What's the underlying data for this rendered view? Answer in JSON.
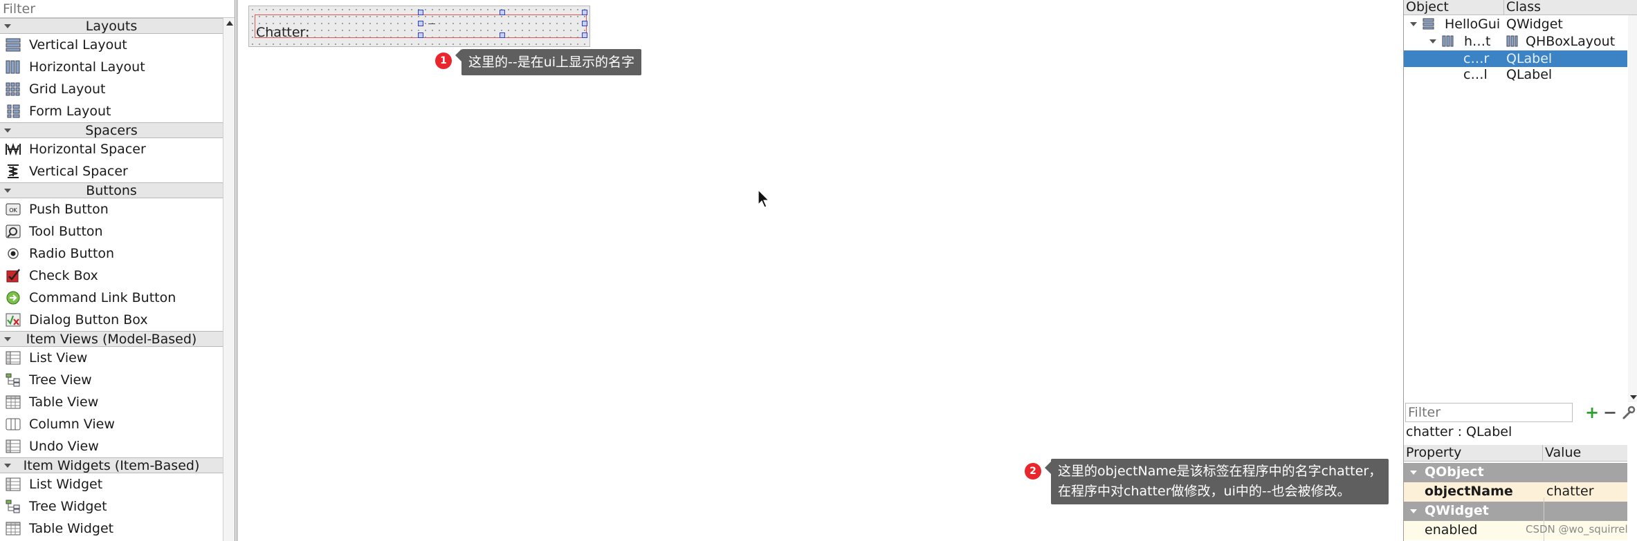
{
  "widget_box": {
    "filter_placeholder": "Filter",
    "categories": [
      {
        "label": "Layouts",
        "items": [
          {
            "label": "Vertical Layout",
            "icon": "vertical-layout-icon"
          },
          {
            "label": "Horizontal Layout",
            "icon": "horizontal-layout-icon"
          },
          {
            "label": "Grid Layout",
            "icon": "grid-layout-icon"
          },
          {
            "label": "Form Layout",
            "icon": "form-layout-icon"
          }
        ]
      },
      {
        "label": "Spacers",
        "items": [
          {
            "label": "Horizontal Spacer",
            "icon": "horizontal-spacer-icon"
          },
          {
            "label": "Vertical Spacer",
            "icon": "vertical-spacer-icon"
          }
        ]
      },
      {
        "label": "Buttons",
        "items": [
          {
            "label": "Push Button",
            "icon": "push-button-icon"
          },
          {
            "label": "Tool Button",
            "icon": "tool-button-icon"
          },
          {
            "label": "Radio Button",
            "icon": "radio-button-icon"
          },
          {
            "label": "Check Box",
            "icon": "check-box-icon"
          },
          {
            "label": "Command Link Button",
            "icon": "command-link-icon"
          },
          {
            "label": "Dialog Button Box",
            "icon": "dialog-button-box-icon"
          }
        ]
      },
      {
        "label": "Item Views (Model-Based)",
        "items": [
          {
            "label": "List View",
            "icon": "list-view-icon"
          },
          {
            "label": "Tree View",
            "icon": "tree-view-icon"
          },
          {
            "label": "Table View",
            "icon": "table-view-icon"
          },
          {
            "label": "Column View",
            "icon": "column-view-icon"
          },
          {
            "label": "Undo View",
            "icon": "undo-view-icon"
          }
        ]
      },
      {
        "label": "Item Widgets (Item-Based)",
        "items": [
          {
            "label": "List Widget",
            "icon": "list-widget-icon"
          },
          {
            "label": "Tree Widget",
            "icon": "tree-widget-icon"
          },
          {
            "label": "Table Widget",
            "icon": "table-widget-icon"
          }
        ]
      }
    ]
  },
  "canvas": {
    "form_label": "Chatter:",
    "selected_text": "--",
    "callout_1": {
      "number": "1",
      "text": "这里的--是在ui上显示的名字"
    },
    "callout_2": {
      "number": "2",
      "line1": "这里的objectName是该标签在程序中的名字chatter，",
      "line2": "在程序中对chatter做修改，ui中的--也会被修改。"
    }
  },
  "object_inspector": {
    "col_object": "Object",
    "col_class": "Class",
    "rows": [
      {
        "object": "HelloGui",
        "class": "QWidget",
        "icon": "widget-icon",
        "selected": false
      },
      {
        "object": "h…t",
        "class": "QHBoxLayout",
        "icon": "hbox-layout-icon",
        "selected": false
      },
      {
        "object": "c…r",
        "class": "QLabel",
        "selected": true
      },
      {
        "object": "c…l",
        "class": "QLabel",
        "selected": false
      }
    ]
  },
  "property_editor": {
    "filter_placeholder": "Filter",
    "title": "chatter : QLabel",
    "col_property": "Property",
    "col_value": "Value",
    "group_qobject": "QObject",
    "object_name_prop": "objectName",
    "object_name_value": "chatter",
    "group_qwidget": "QWidget",
    "enabled_prop": "enabled"
  },
  "watermark": "CSDN @wo_squirrel",
  "colors": {
    "selection": "#3b83c4",
    "badge": "#e8262c",
    "callout": "#5f5f5f",
    "handle_border": "#2b3fc9",
    "layout_frame": "#e05656"
  }
}
